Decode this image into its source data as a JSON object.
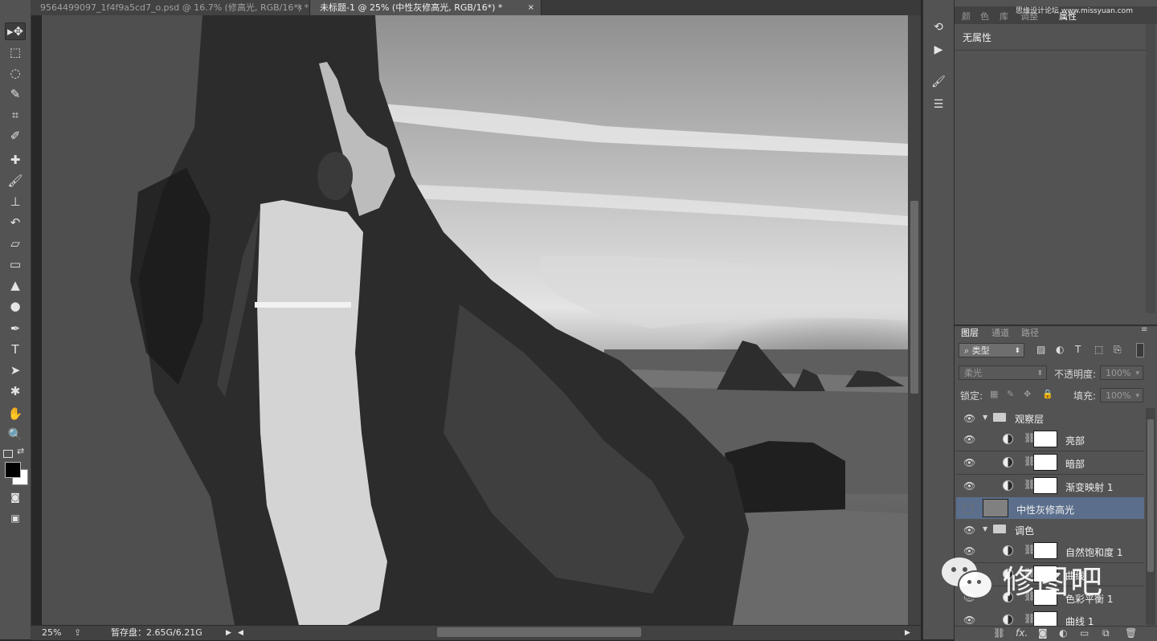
{
  "documents": {
    "tab1": "9564499097_1f4f9a5cd7_o.psd @ 16.7% (修高光, RGB/16*) *",
    "tab2": "未标题-1 @ 25% (中性灰修高光, RGB/16*) *",
    "close_glyph": "×"
  },
  "tools": [
    {
      "name": "move-tool-icon",
      "glyph": "▸✥"
    },
    {
      "name": "marquee-tool-icon",
      "glyph": "⬚"
    },
    {
      "name": "lasso-tool-icon",
      "glyph": "◌"
    },
    {
      "name": "quick-selection-icon",
      "glyph": "✎"
    },
    {
      "name": "crop-tool-icon",
      "glyph": "⌗"
    },
    {
      "name": "eyedropper-icon",
      "glyph": "✐"
    },
    {
      "name": "healing-brush-icon",
      "glyph": "✚"
    },
    {
      "name": "brush-tool-icon",
      "glyph": "🖌"
    },
    {
      "name": "clone-stamp-icon",
      "glyph": "⊥"
    },
    {
      "name": "history-brush-icon",
      "glyph": "↶"
    },
    {
      "name": "eraser-icon",
      "glyph": "▱"
    },
    {
      "name": "gradient-tool-icon",
      "glyph": "▭"
    },
    {
      "name": "blur-tool-icon",
      "glyph": "▲"
    },
    {
      "name": "dodge-tool-icon",
      "glyph": "●"
    },
    {
      "name": "pen-tool-icon",
      "glyph": "✒"
    },
    {
      "name": "type-tool-icon",
      "glyph": "T"
    },
    {
      "name": "path-selection-icon",
      "glyph": "➤"
    },
    {
      "name": "custom-shape-icon",
      "glyph": "✱"
    },
    {
      "name": "hand-tool-icon",
      "glyph": "✋"
    },
    {
      "name": "zoom-tool-icon",
      "glyph": "🔍"
    }
  ],
  "status": {
    "zoom": "25%",
    "scratch": "暂存盘：2.65G/6.21G"
  },
  "panels": {
    "prop_tabs": [
      "颜",
      "色",
      "库",
      "调整",
      "属性"
    ],
    "properties_text": "无属性",
    "layer_tabs": [
      "图层",
      "通道",
      "路径"
    ],
    "filter_kind": "类型",
    "blend_mode": "柔光",
    "opacity_label": "不透明度:",
    "opacity_value": "100%",
    "lock_label": "锁定:",
    "fill_label": "填充:",
    "fill_value": "100%"
  },
  "layers": [
    {
      "type": "group",
      "name": "观察层",
      "visible": true
    },
    {
      "type": "adjustment",
      "name": "亮部",
      "visible": true
    },
    {
      "type": "adjustment",
      "name": "暗部",
      "visible": true
    },
    {
      "type": "adjustment",
      "name": "渐变映射 1",
      "visible": true
    },
    {
      "type": "pixel",
      "name": "中性灰修高光",
      "visible": false,
      "selected": true
    },
    {
      "type": "group",
      "name": "调色",
      "visible": true
    },
    {
      "type": "adjustment",
      "name": "自然饱和度 1",
      "visible": true
    },
    {
      "type": "adjustment",
      "name": "曲线",
      "visible": true
    },
    {
      "type": "adjustment",
      "name": "色彩平衡 1",
      "visible": true
    },
    {
      "type": "adjustment",
      "name": "曲线 1",
      "visible": true
    }
  ],
  "watermarks": {
    "top_right": "思缘设计论坛 www.missyuan.com",
    "bottom_right": "修图吧"
  },
  "colors": {
    "workspace_bg": "#535353",
    "selected_layer": "#5b6f8c",
    "dark_bg": "#282828"
  }
}
